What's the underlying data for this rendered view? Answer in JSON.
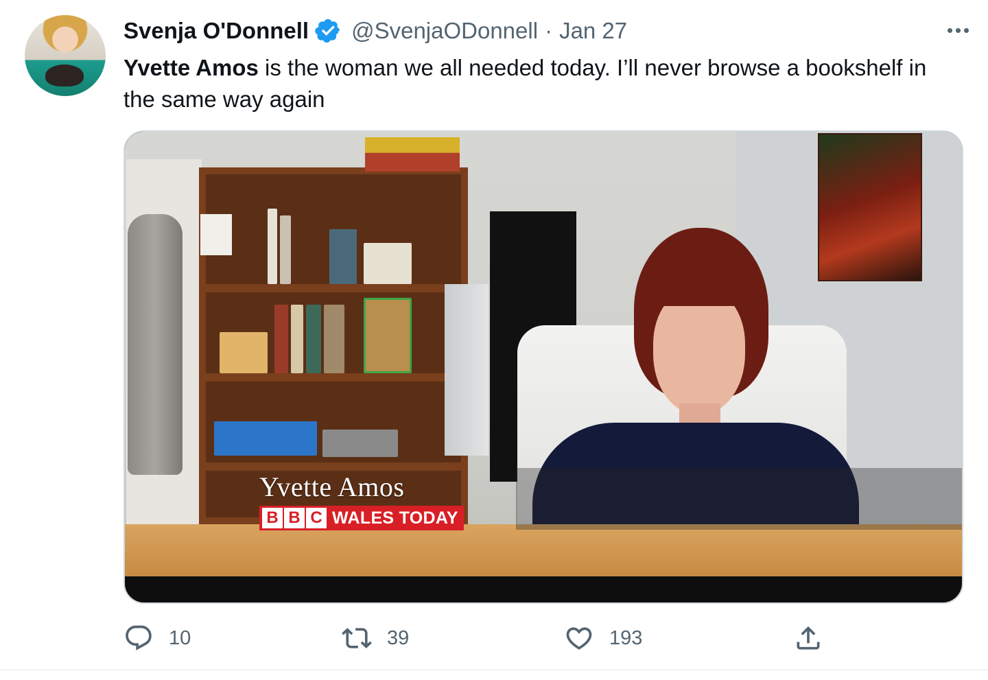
{
  "tweet": {
    "display_name": "Svenja O'Donnell",
    "handle": "@SvenjaODonnell",
    "separator": "·",
    "date": "Jan 27",
    "text_bold": "Yvette Amos",
    "text_rest": " is the woman we all needed today. I’ll never browse a bookshelf in the same way again",
    "verified": true
  },
  "media": {
    "caption_name": "Yvette Amos",
    "bbc_letters": [
      "B",
      "B",
      "C"
    ],
    "programme": "WALES TODAY",
    "brand_color": "#d81f26"
  },
  "actions": {
    "reply_count": "10",
    "retweet_count": "39",
    "like_count": "193"
  },
  "icons": {
    "reply": "reply-icon",
    "retweet": "retweet-icon",
    "like": "heart-icon",
    "share": "share-icon",
    "more": "more-icon",
    "verified": "verified-badge-icon"
  },
  "colors": {
    "verified_blue": "#1d9bf0",
    "secondary_text": "#536471"
  }
}
